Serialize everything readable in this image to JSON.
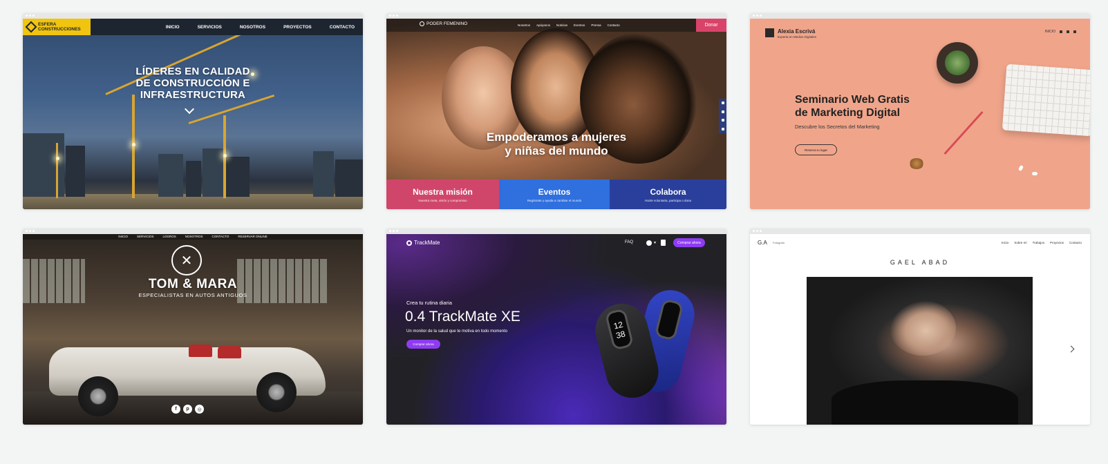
{
  "esfera": {
    "logo_line1": "ESFERA",
    "logo_line2": "CONSTRUCCIONES",
    "nav": [
      "INICIO",
      "SERVICIOS",
      "NOSOTROS",
      "PROYECTOS",
      "CONTACTO"
    ],
    "hero_line1": "LÍDERES EN CALIDAD",
    "hero_line2": "DE CONSTRUCCIÓN E",
    "hero_line3": "INFRAESTRUCTURA",
    "logo_color": "#f1c40f"
  },
  "poder": {
    "logo": "PODER FEMENINO",
    "nav": [
      "Nosotros",
      "Apóyanos",
      "Noticias",
      "Eventos",
      "Prensa",
      "Contacto"
    ],
    "donate": "Donar",
    "hero_line1": "Empoderamos a mujeres",
    "hero_line2": "y niñas del mundo",
    "tiles": [
      {
        "title": "Nuestra misión",
        "sub": "Nuestra meta, visión y compromiso",
        "color": "#d0466a"
      },
      {
        "title": "Eventos",
        "sub": "Regístrate y ayuda a cambiar el mundo",
        "color": "#2f6fde"
      },
      {
        "title": "Colabora",
        "sub": "Hazte voluntaria, participa o dona",
        "color": "#2a3f9b"
      }
    ]
  },
  "alexia": {
    "name": "Alexia Escrivá",
    "tagline": "Experta en Medios Digitales",
    "nav_link": "INICIO",
    "headline_line1": "Seminario Web Gratis",
    "headline_line2": "de Marketing Digital",
    "sub": "Descubre los Secretos del Marketing",
    "cta": "Reserva tu lugar",
    "bg_color": "#f0a58b"
  },
  "tommara": {
    "nav": [
      "INICIO",
      "SERVICIOS",
      "LOGROS",
      "NOSOTROS",
      "CONTACTO",
      "RESERVAR ONLINE"
    ],
    "title": "TOM & MARA",
    "tagline": "ESPECIALISTAS EN AUTOS ANTIGUOS",
    "social": [
      "facebook-icon",
      "pinterest-icon",
      "instagram-icon"
    ]
  },
  "trackmate": {
    "logo": "TrackMate",
    "faq": "FAQ",
    "buy_top": "Comprar ahora",
    "eyebrow": "Crea tu rutina diaria",
    "title": "0.4 TrackMate XE",
    "desc": "Un monitor de la salud que te motiva en todo momento",
    "buy": "Comprar ahora",
    "watch_time_line1": "12",
    "watch_time_line2": "38",
    "accent": "#8e3cf2"
  },
  "gael": {
    "monogram": "G.A",
    "crumb": "Fotógrafo",
    "nav": [
      "Inicio",
      "Sobre mí",
      "Trabajos",
      "Proyectos",
      "Contacto"
    ],
    "title": "GAEL ABAD"
  }
}
